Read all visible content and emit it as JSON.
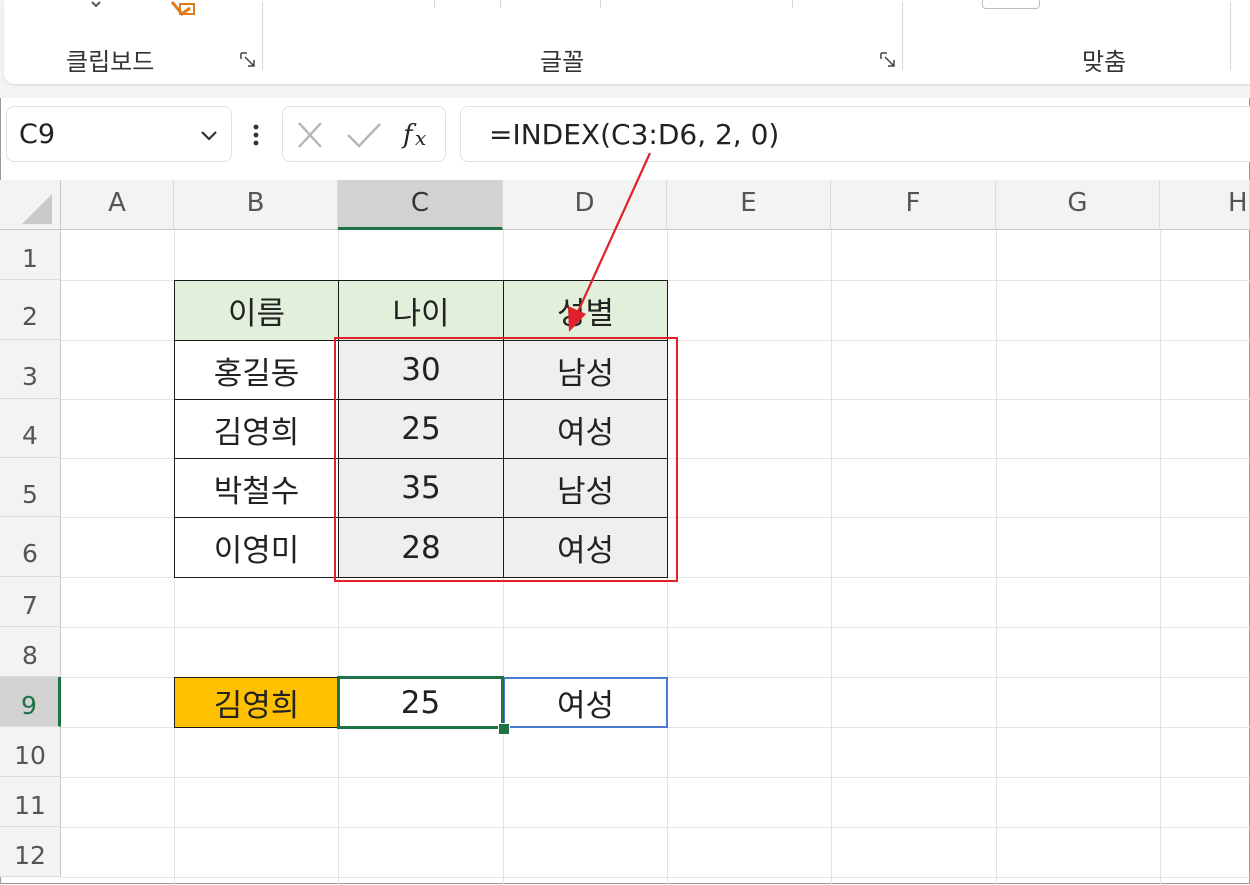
{
  "ribbon": {
    "groups": [
      {
        "label": "클립보드"
      },
      {
        "label": "글꼴"
      },
      {
        "label": "맞춤"
      }
    ]
  },
  "formula_bar": {
    "name_box": "C9",
    "formula": "=INDEX(C3:D6, 2, 0)"
  },
  "columns": [
    "A",
    "B",
    "C",
    "D",
    "E",
    "F",
    "G",
    "H"
  ],
  "rows": [
    "1",
    "2",
    "3",
    "4",
    "5",
    "6",
    "7",
    "8",
    "9",
    "10",
    "11",
    "12"
  ],
  "table": {
    "headers": [
      "이름",
      "나이",
      "성별"
    ],
    "rows": [
      [
        "홍길동",
        "30",
        "남성"
      ],
      [
        "김영희",
        "25",
        "여성"
      ],
      [
        "박철수",
        "35",
        "남성"
      ],
      [
        "이영미",
        "28",
        "여성"
      ]
    ]
  },
  "result": {
    "name": "김영희",
    "age": "25",
    "gender": "여성"
  },
  "colors": {
    "header_fill": "#e2efda",
    "data_fill": "#efefef",
    "result_name_fill": "#ffc000",
    "selection": "#1f7246",
    "highlight_box": "#e0202a",
    "spill_border": "#4a7bd0"
  },
  "icons": [
    "chevron-down-icon",
    "more-options-icon",
    "cancel-icon",
    "enter-icon",
    "insert-function-icon",
    "dialog-launcher-icon"
  ]
}
